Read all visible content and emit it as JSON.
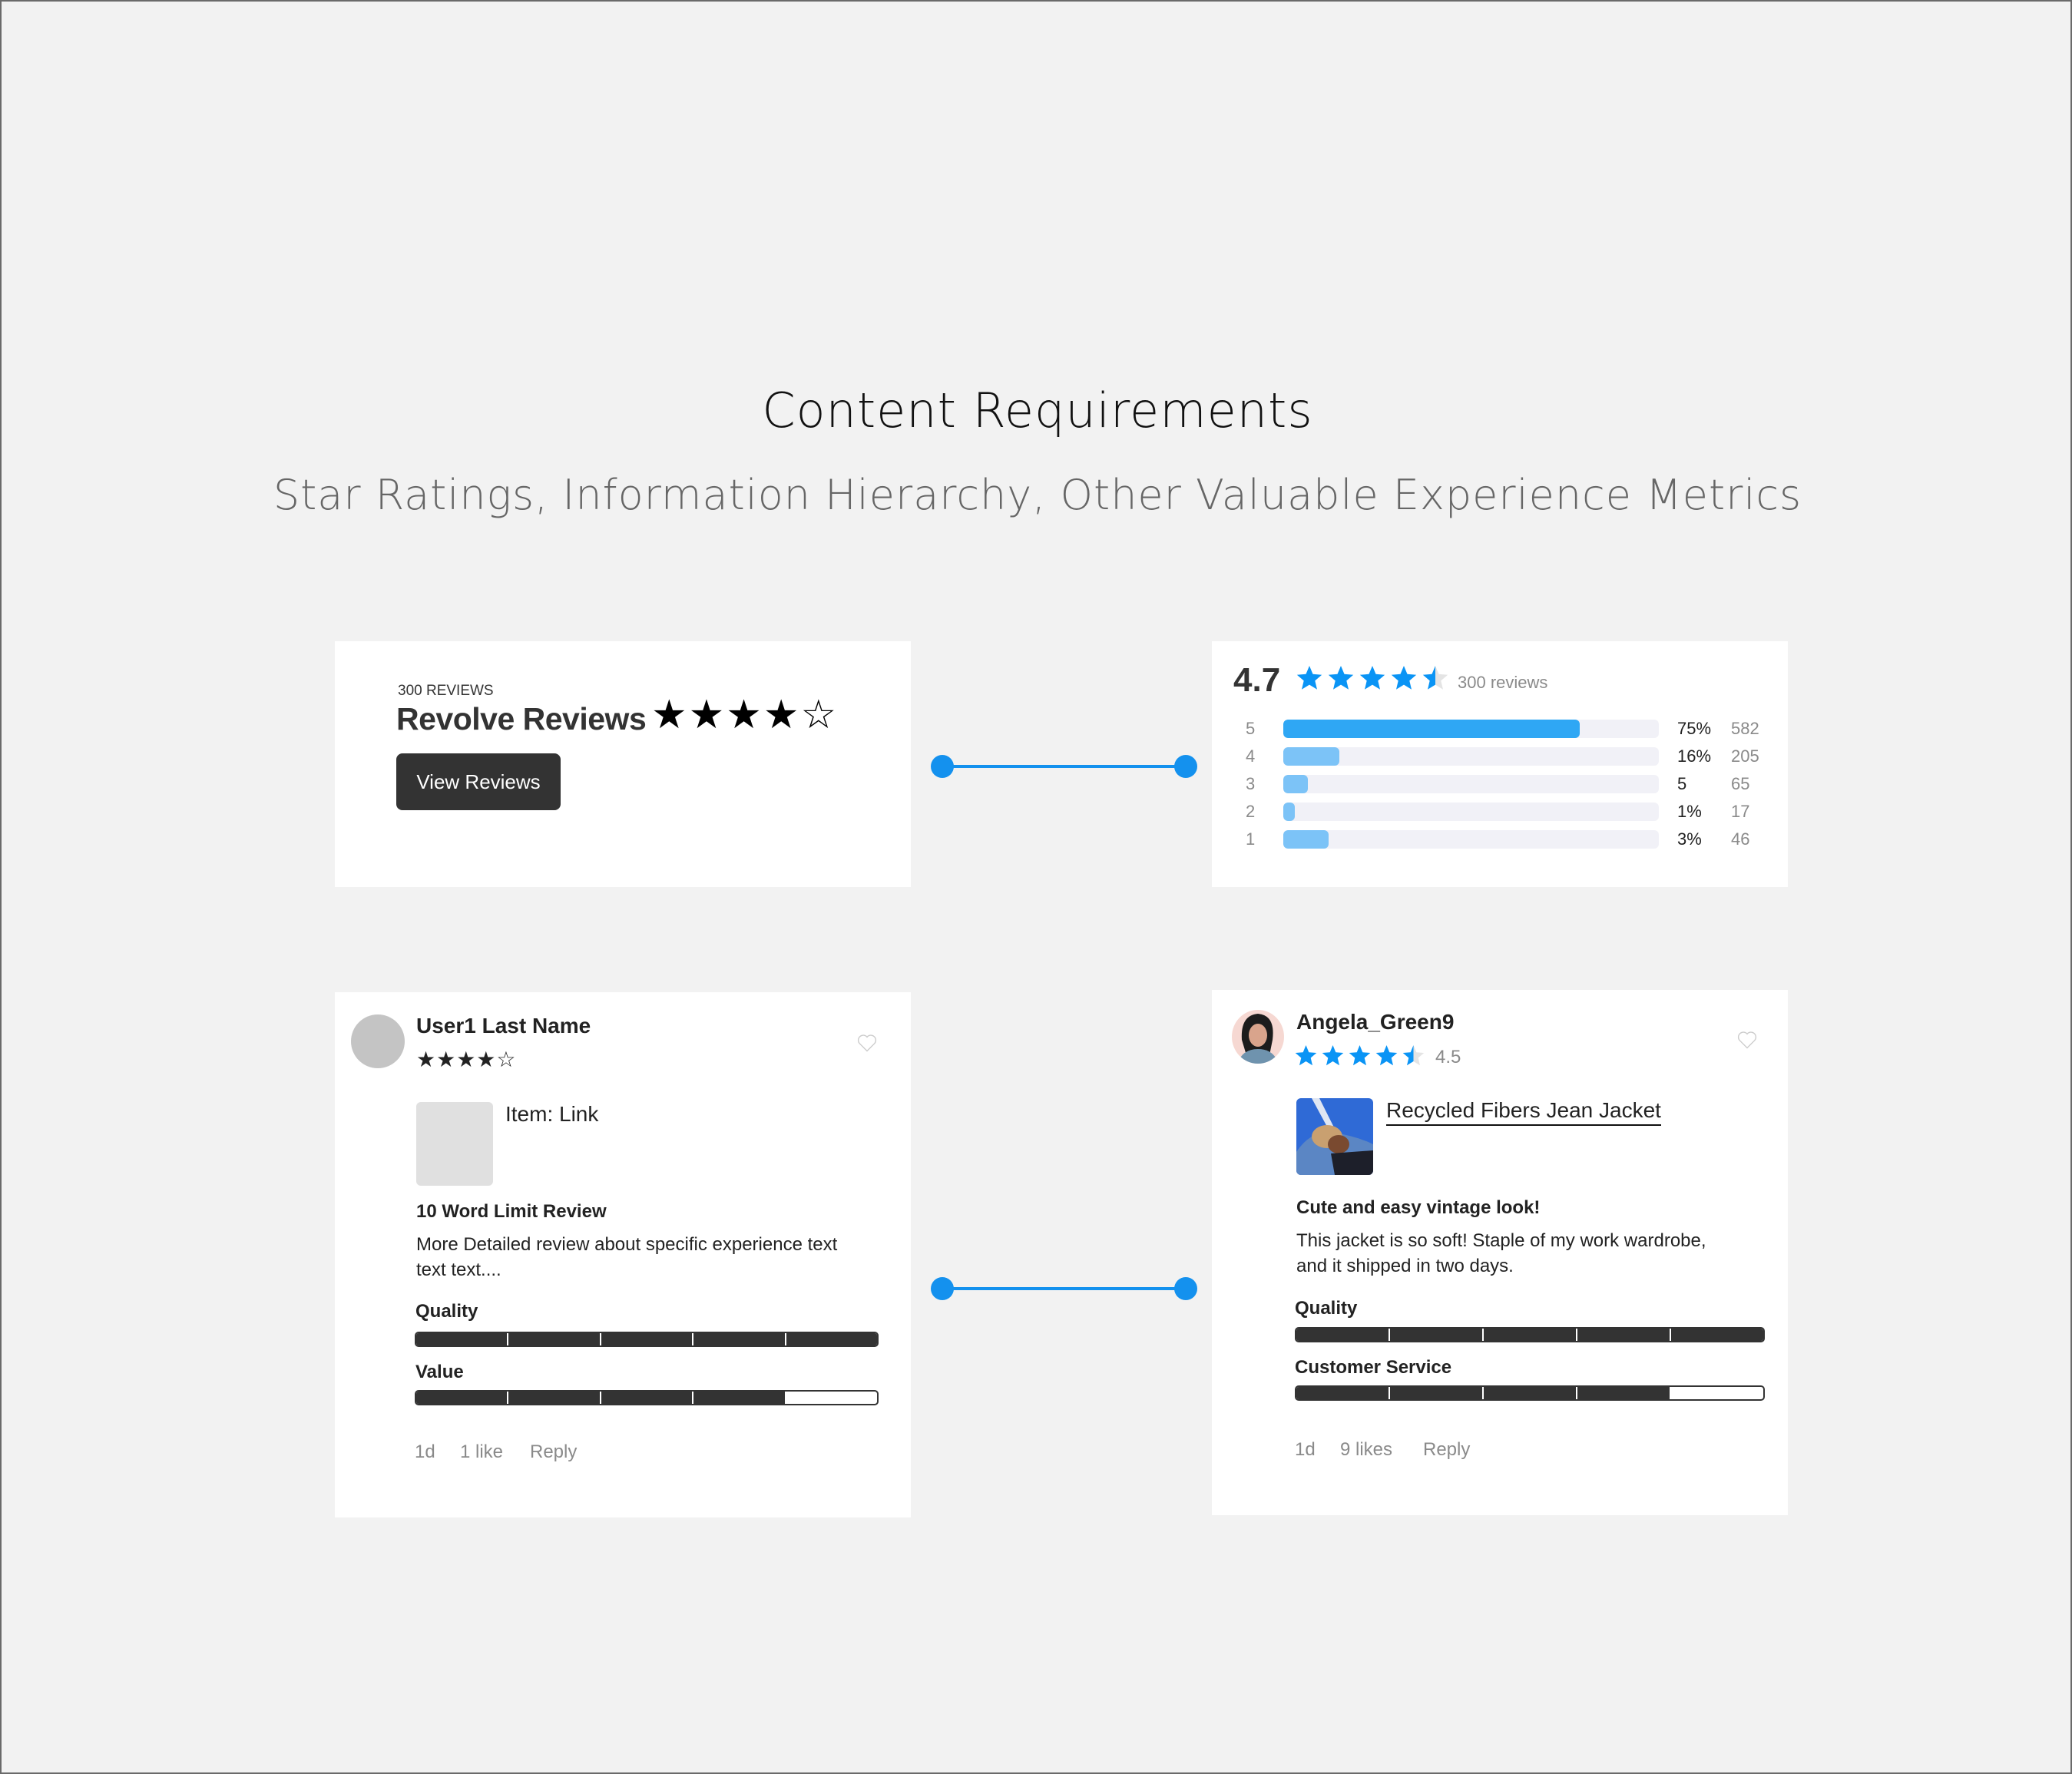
{
  "colors": {
    "accent": "#1491ee",
    "star_blue": "#0a94f5",
    "bar_primary": "#2fa7f4",
    "bar_secondary": "#7cc3f7",
    "dark": "#333333"
  },
  "header": {
    "title": "Content Requirements",
    "subtitle": "Star Ratings, Information Hierarchy, Other Valuable Experience Metrics"
  },
  "summary_card": {
    "count_label": "300 REVIEWS",
    "title": "Revolve Reviews",
    "stars": "★★★★",
    "empty_star": "☆",
    "rating": 4,
    "button_label": "View Reviews"
  },
  "breakdown_card": {
    "average": "4.7",
    "rating": 4.7,
    "reviews_label": "300 reviews",
    "rows": [
      {
        "star": "5",
        "percent": "75%",
        "count": "582",
        "fill": 0.79
      },
      {
        "star": "4",
        "percent": "16%",
        "count": "205",
        "fill": 0.15
      },
      {
        "star": "3",
        "percent": "5",
        "count": "65",
        "fill": 0.065
      },
      {
        "star": "2",
        "percent": "1%",
        "count": "17",
        "fill": 0.03
      },
      {
        "star": "1",
        "percent": "3%",
        "count": "46",
        "fill": 0.12
      }
    ]
  },
  "review_wireframe": {
    "user_name": "User1 Last Name",
    "stars": "★★★★☆",
    "rating": 4,
    "item_label": "Item: Link",
    "review_title": "10 Word Limit Review",
    "review_body": "More Detailed review about specific experience text text text....",
    "metrics": [
      {
        "label": "Quality",
        "value": 5,
        "max": 5
      },
      {
        "label": "Value",
        "value": 4,
        "max": 5
      }
    ],
    "footer": {
      "age": "1d",
      "likes": "1 like",
      "reply": "Reply"
    },
    "icons": {
      "like": "heart-icon"
    }
  },
  "review_final": {
    "user_name": "Angela_Green9",
    "rating": 4.5,
    "rating_label": "4.5",
    "item_link": "Recycled Fibers Jean Jacket",
    "review_title": "Cute and easy vintage look!",
    "review_body_line1": "This jacket is so soft! Staple of my work wardrobe,",
    "review_body_line2": "and it shipped in two days.",
    "metrics": [
      {
        "label": "Quality",
        "value": 5,
        "max": 5
      },
      {
        "label": "Customer Service",
        "value": 4,
        "max": 5
      }
    ],
    "footer": {
      "age": "1d",
      "likes": "9 likes",
      "reply": "Reply"
    },
    "icons": {
      "like": "heart-icon"
    }
  }
}
